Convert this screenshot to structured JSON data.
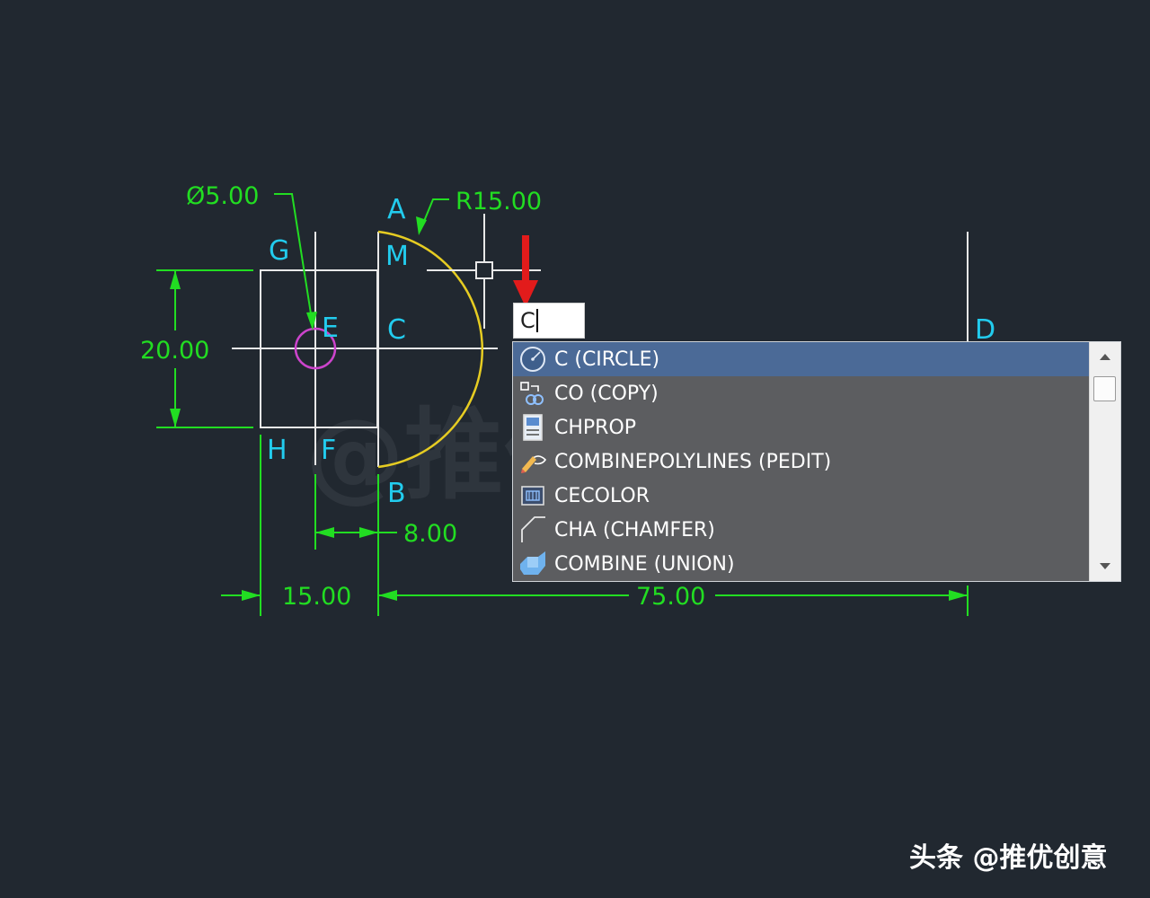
{
  "drawing": {
    "point_labels": {
      "a": "A",
      "m": "M",
      "c": "C",
      "g": "G",
      "e": "E",
      "h": "H",
      "f": "F",
      "b": "B",
      "d": "D"
    },
    "dimensions": {
      "diameter": "Ø5.00",
      "radius": "R15.00",
      "height": "20.00",
      "offset": "8.00",
      "left_width": "15.00",
      "total_width": "75.00"
    },
    "colors": {
      "background": "#212830",
      "geometry": "#e8e8e8",
      "dimension": "#22dd22",
      "point_label": "#22ccee",
      "arc": "#e6cc22",
      "hole": "#cc44cc",
      "arrow": "#e21b1b"
    },
    "background_watermark": "@推优创意"
  },
  "command_line": {
    "input_value": "C"
  },
  "autocomplete": {
    "items": [
      {
        "label": "C (CIRCLE)",
        "icon": "circle-icon",
        "selected": true
      },
      {
        "label": "CO (COPY)",
        "icon": "copy-icon",
        "selected": false
      },
      {
        "label": "CHPROP",
        "icon": "properties-icon",
        "selected": false
      },
      {
        "label": "COMBINEPOLYLINES (PEDIT)",
        "icon": "pedit-icon",
        "selected": false
      },
      {
        "label": "CECOLOR",
        "icon": "color-icon",
        "selected": false
      },
      {
        "label": "CHA (CHAMFER)",
        "icon": "chamfer-icon",
        "selected": false
      },
      {
        "label": "COMBINE (UNION)",
        "icon": "union-icon",
        "selected": false
      }
    ]
  },
  "watermark": "头条 @推优创意"
}
